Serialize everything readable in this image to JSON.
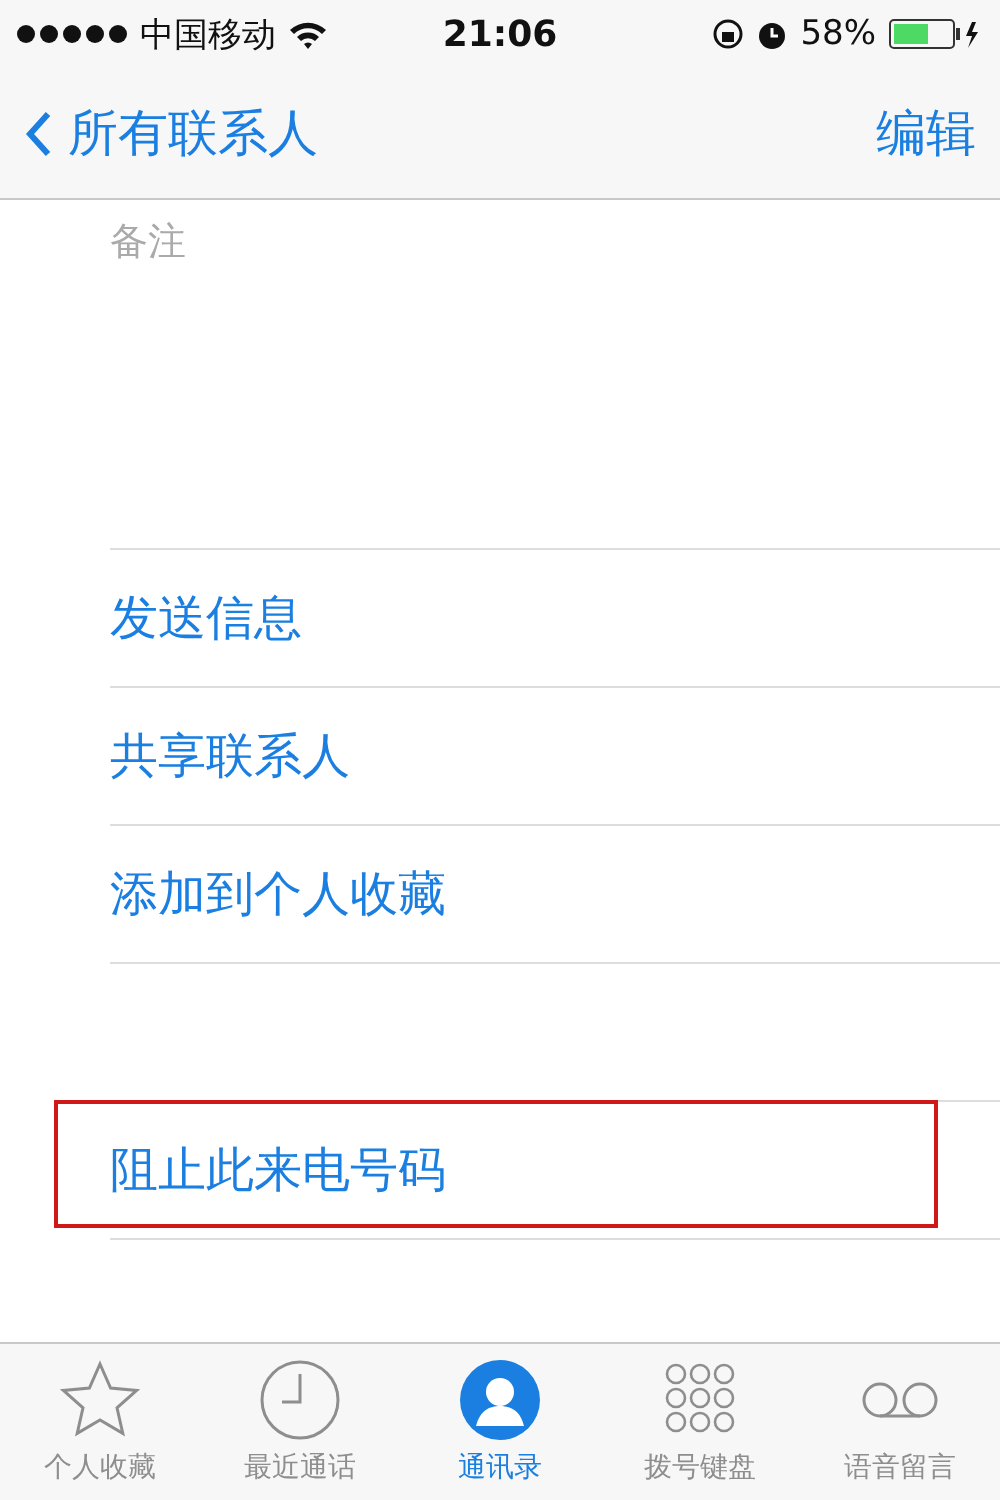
{
  "status_bar": {
    "carrier": "中国移动",
    "time": "21:06",
    "battery": "58%"
  },
  "nav": {
    "back": "所有联系人",
    "action": "编辑"
  },
  "notes": {
    "label": "备注"
  },
  "actions": [
    {
      "label": "发送信息"
    },
    {
      "label": "共享联系人"
    },
    {
      "label": "添加到个人收藏"
    }
  ],
  "block": {
    "label": "阻止此来电号码",
    "highlighted": true
  },
  "tabs": [
    {
      "label": "个人收藏",
      "kind": "star",
      "selected": false
    },
    {
      "label": "最近通话",
      "kind": "clock",
      "selected": false
    },
    {
      "label": "通讯录",
      "kind": "person",
      "selected": true
    },
    {
      "label": "拨号键盘",
      "kind": "keypad",
      "selected": false
    },
    {
      "label": "语音留言",
      "kind": "voicemail",
      "selected": false
    }
  ]
}
